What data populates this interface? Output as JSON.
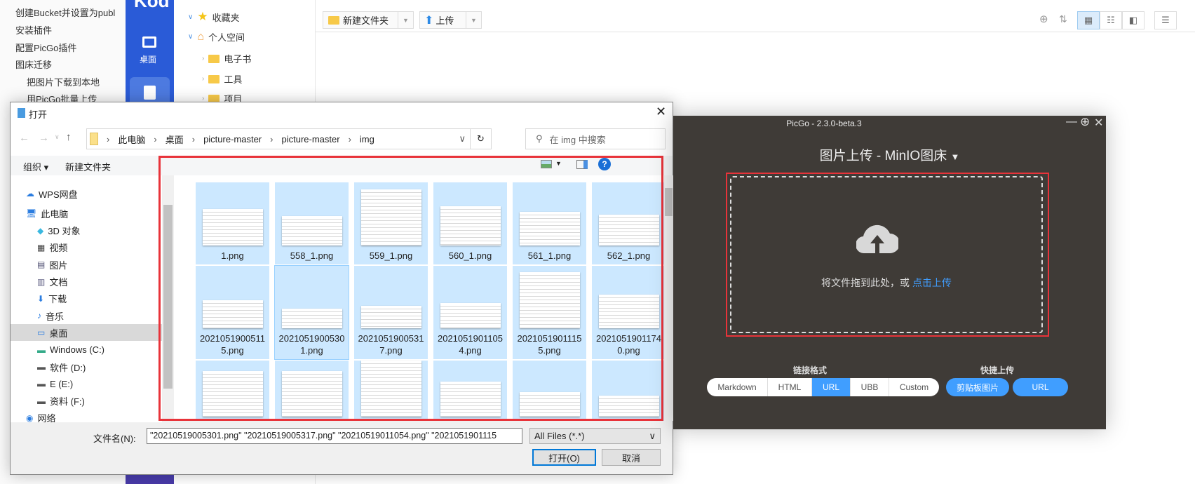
{
  "notes": {
    "items": [
      "创建Bucket并设置为publ",
      "安装插件",
      "配置PicGo插件",
      "图床迁移",
      "把图片下载到本地",
      "用PicGo批量上传"
    ]
  },
  "sidebar": {
    "logo": "Kod",
    "desktop_label": "桌面"
  },
  "tree": {
    "items": [
      "收藏夹",
      "个人空间",
      "电子书",
      "工具",
      "项目"
    ]
  },
  "toolbar": {
    "new_folder": "新建文件夹",
    "upload": "上传"
  },
  "dialog": {
    "title": "打开",
    "breadcrumb": [
      "此电脑",
      "桌面",
      "picture-master",
      "picture-master",
      "img"
    ],
    "search_placeholder": "在 img 中搜索",
    "organize": "组织 ▾",
    "new_folder": "新建文件夹",
    "nav": [
      "WPS网盘",
      "此电脑",
      "3D 对象",
      "视频",
      "图片",
      "文档",
      "下载",
      "音乐",
      "桌面",
      "Windows (C:)",
      "软件 (D:)",
      "E (E:)",
      "资料 (F:)",
      "网络"
    ],
    "nav_selected": "桌面",
    "files": [
      "1.png",
      "558_1.png",
      "559_1.png",
      "560_1.png",
      "561_1.png",
      "562_1.png",
      "20210519005115.png",
      "20210519005301.png",
      "20210519005317.png",
      "20210519011054.png",
      "20210519011155.png",
      "20210519011740.png",
      "",
      "",
      "",
      "",
      "",
      ""
    ],
    "filename_label": "文件名(N):",
    "filename_value": "\"20210519005301.png\" \"20210519005317.png\" \"20210519011054.png\" \"2021051901115",
    "filter": "All Files (*.*)",
    "open": "打开(O)",
    "cancel": "取消"
  },
  "picgo": {
    "title": "PicGo - 2.3.0-beta.3",
    "heading": "图片上传 - MinIO图床",
    "drop_text": "将文件拖到此处，或 ",
    "drop_link": "点击上传",
    "link_format_label": "链接格式",
    "quick_upload_label": "快捷上传",
    "formats": [
      "Markdown",
      "HTML",
      "URL",
      "UBB",
      "Custom"
    ],
    "active_format": "URL",
    "quick": [
      "剪贴板图片",
      "URL"
    ],
    "accent": "#409eff"
  }
}
